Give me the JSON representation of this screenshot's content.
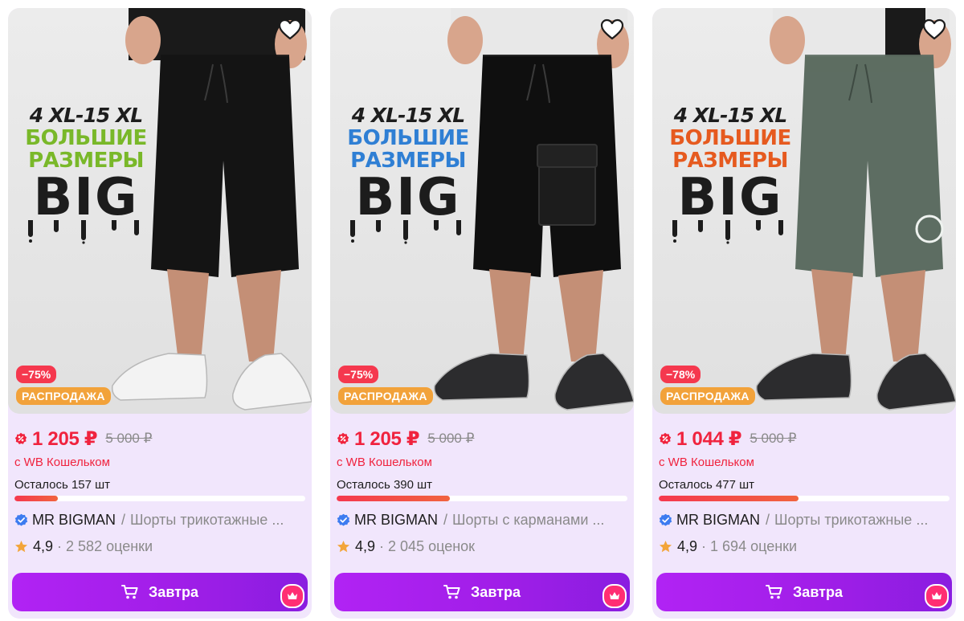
{
  "products": [
    {
      "accent_color": "#79b829",
      "shorts_color": "#141414",
      "shoe_color": "#f3f3f3",
      "style": "loose",
      "promo": {
        "sizes": "4 XL-15 XL",
        "line1": "БОЛЬШИЕ",
        "line2": "РАЗМЕРЫ",
        "big": "BIG"
      },
      "discount": "−75%",
      "sale_label": "РАСПРОДАЖА",
      "price": "1 205 ₽",
      "old_price": "5 000 ₽",
      "wallet": "с WB Кошельком",
      "stock": "Осталось 157 шт",
      "stock_fill": 0.15,
      "brand": "MR BIGMAN",
      "name": "Шорты трикотажные ...",
      "rating": "4,9",
      "reviews": "2 582 оценки",
      "cart_label": "Завтра"
    },
    {
      "accent_color": "#2f7fd4",
      "shorts_color": "#0f0f0f",
      "shoe_color": "#2c2c2e",
      "style": "cargo",
      "promo": {
        "sizes": "4 XL-15 XL",
        "line1": "БОЛЬШИЕ",
        "line2": "РАЗМЕРЫ",
        "big": "BIG"
      },
      "discount": "−75%",
      "sale_label": "РАСПРОДАЖА",
      "price": "1 205 ₽",
      "old_price": "5 000 ₽",
      "wallet": "с WB Кошельком",
      "stock": "Осталось 390 шт",
      "stock_fill": 0.39,
      "brand": "MR BIGMAN",
      "name": "Шорты с карманами ...",
      "rating": "4,9",
      "reviews": "2 045 оценок",
      "cart_label": "Завтра"
    },
    {
      "accent_color": "#e65a1f",
      "shorts_color": "#5d6d62",
      "shoe_color": "#2c2c2e",
      "style": "print",
      "promo": {
        "sizes": "4 XL-15 XL",
        "line1": "БОЛЬШИЕ",
        "line2": "РАЗМЕРЫ",
        "big": "BIG"
      },
      "discount": "−78%",
      "sale_label": "РАСПРОДАЖА",
      "price": "1 044 ₽",
      "old_price": "5 000 ₽",
      "wallet": "с WB Кошельком",
      "stock": "Осталось 477 шт",
      "stock_fill": 0.48,
      "brand": "MR BIGMAN",
      "name": "Шорты трикотажные ...",
      "rating": "4,9",
      "reviews": "1 694 оценки",
      "cart_label": "Завтра"
    }
  ],
  "icons": {
    "favorite": "heart-icon",
    "price_badge": "discount-badge-icon",
    "verified": "verified-check-icon",
    "rating": "star-icon",
    "cart": "cart-icon",
    "premium": "crown-icon"
  },
  "colors": {
    "card_bg": "#f1e6fc",
    "price_red": "#f0233e",
    "discount_red": "#f5384e",
    "sale_orange": "#f2a23a",
    "button_purple": "#a11ee8",
    "star": "#f3a53a",
    "verified_blue": "#3d7cf0",
    "crown_pink": "#ff2e73"
  }
}
